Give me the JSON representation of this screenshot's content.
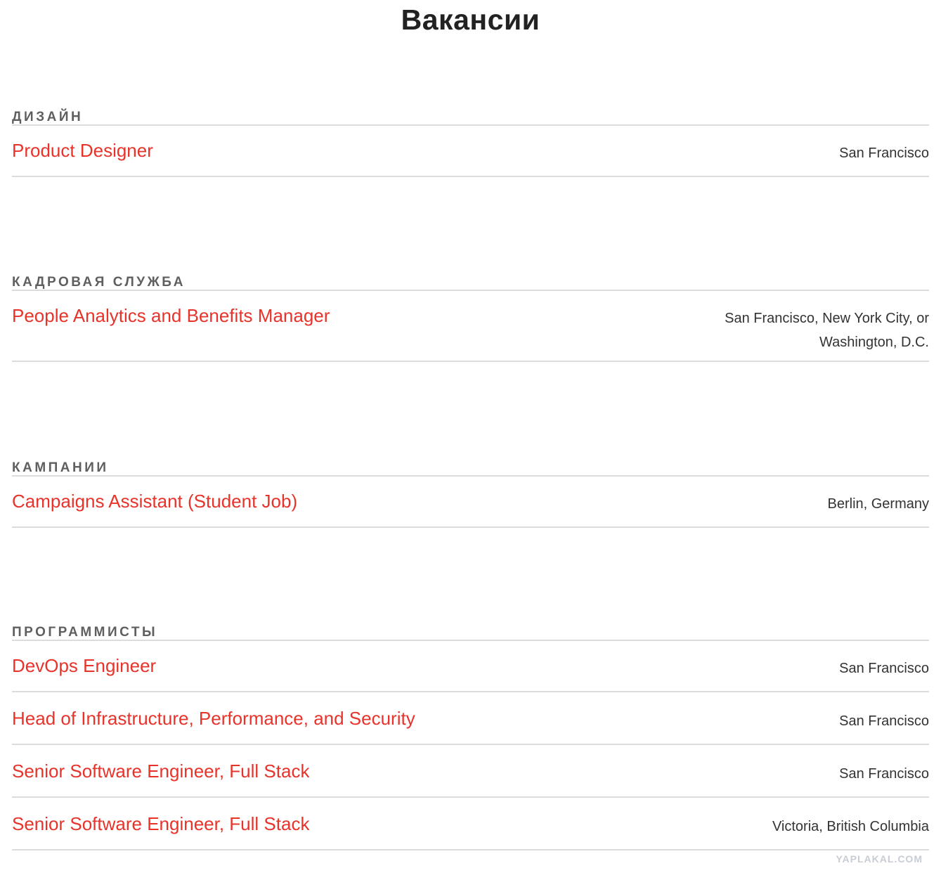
{
  "page": {
    "title": "Вакансии"
  },
  "sections": [
    {
      "heading": "ДИЗАЙН",
      "jobs": [
        {
          "title": "Product Designer",
          "location": "San Francisco"
        }
      ]
    },
    {
      "heading": "КАДРОВАЯ СЛУЖБА",
      "jobs": [
        {
          "title": "People Analytics and Benefits Manager",
          "location": "San Francisco, New York City, or Washington, D.C."
        }
      ]
    },
    {
      "heading": "КАМПАНИИ",
      "jobs": [
        {
          "title": "Campaigns Assistant (Student Job)",
          "location": "Berlin, Germany"
        }
      ]
    },
    {
      "heading": "ПРОГРАММИСТЫ",
      "jobs": [
        {
          "title": "DevOps Engineer",
          "location": "San Francisco"
        },
        {
          "title": "Head of Infrastructure, Performance, and Security",
          "location": "San Francisco"
        },
        {
          "title": "Senior Software Engineer, Full Stack",
          "location": "San Francisco"
        },
        {
          "title": "Senior Software Engineer, Full Stack",
          "location": "Victoria, British Columbia"
        }
      ]
    }
  ],
  "watermark": "YAPLAKAL.COM",
  "colors": {
    "link": "#e8332b",
    "heading": "#5f5f5f",
    "divider": "#dcdcdc"
  }
}
